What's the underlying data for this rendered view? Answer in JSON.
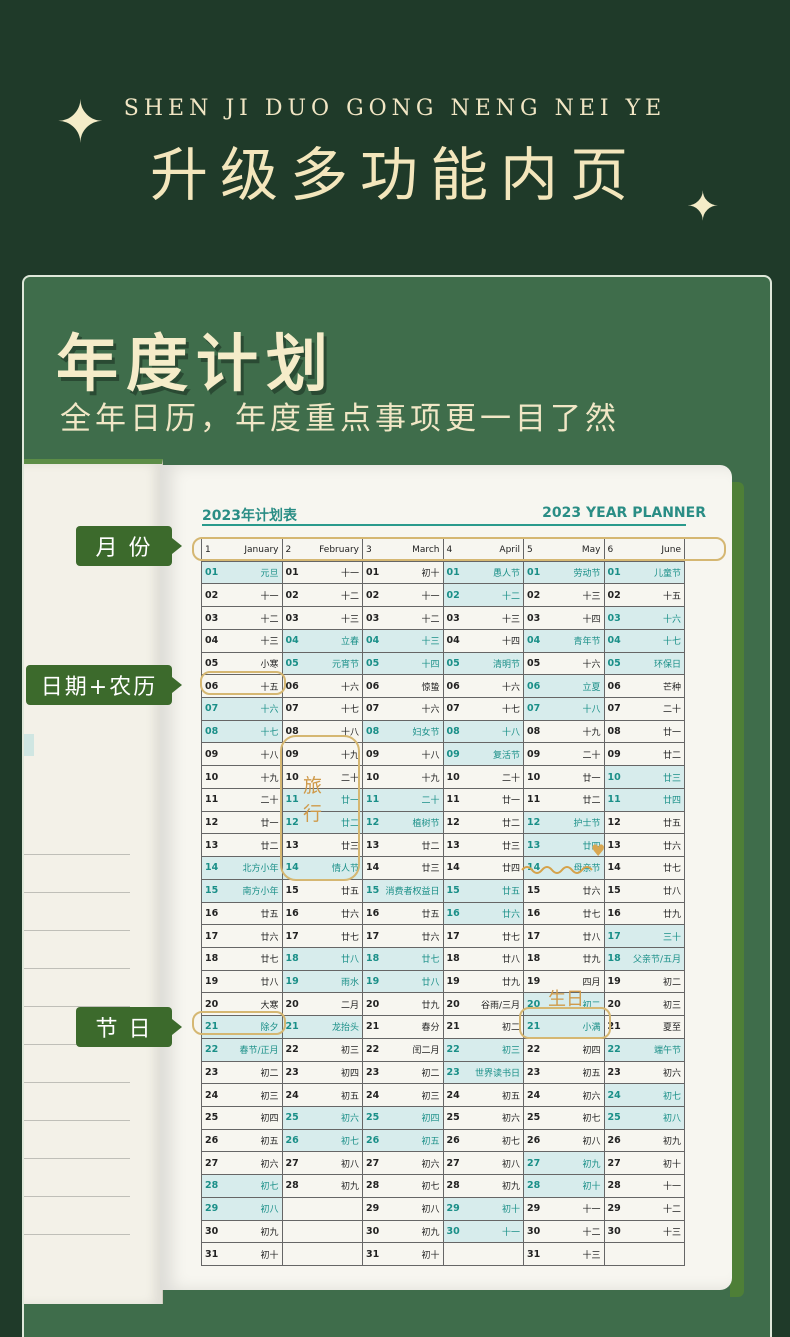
{
  "header": {
    "pinyin": "SHEN JI DUO GONG NENG NEI YE",
    "title": "升级多功能内页",
    "sparkle_glyph": "✦"
  },
  "section": {
    "title": "年度计划",
    "subtitle": "全年日历，年度重点事项更一目了然"
  },
  "callouts": {
    "month": "月 份",
    "date_lunar": "日期+农历",
    "holiday": "节 日"
  },
  "doodles": {
    "travel_1": "旅",
    "travel_2": "行",
    "birthday": "生日",
    "heart": "♥"
  },
  "planner": {
    "title_cn": "2023年计划表",
    "title_en": "2023 YEAR PLANNER",
    "months": [
      {
        "num": "1",
        "name": "January"
      },
      {
        "num": "2",
        "name": "February"
      },
      {
        "num": "3",
        "name": "March"
      },
      {
        "num": "4",
        "name": "April"
      },
      {
        "num": "5",
        "name": "May"
      },
      {
        "num": "6",
        "name": "June"
      }
    ],
    "columns": [
      [
        [
          "01",
          "元旦",
          1
        ],
        [
          "02",
          "十一",
          0
        ],
        [
          "03",
          "十二",
          0
        ],
        [
          "04",
          "十三",
          0
        ],
        [
          "05",
          "小寒",
          0
        ],
        [
          "06",
          "十五",
          0
        ],
        [
          "07",
          "十六",
          1
        ],
        [
          "08",
          "十七",
          1
        ],
        [
          "09",
          "十八",
          0
        ],
        [
          "10",
          "十九",
          0
        ],
        [
          "11",
          "二十",
          0
        ],
        [
          "12",
          "廿一",
          0
        ],
        [
          "13",
          "廿二",
          0
        ],
        [
          "14",
          "北方小年",
          1
        ],
        [
          "15",
          "南方小年",
          1
        ],
        [
          "16",
          "廿五",
          0
        ],
        [
          "17",
          "廿六",
          0
        ],
        [
          "18",
          "廿七",
          0
        ],
        [
          "19",
          "廿八",
          0
        ],
        [
          "20",
          "大寒",
          0
        ],
        [
          "21",
          "除夕",
          1
        ],
        [
          "22",
          "春节/正月",
          1
        ],
        [
          "23",
          "初二",
          0
        ],
        [
          "24",
          "初三",
          0
        ],
        [
          "25",
          "初四",
          0
        ],
        [
          "26",
          "初五",
          0
        ],
        [
          "27",
          "初六",
          0
        ],
        [
          "28",
          "初七",
          1
        ],
        [
          "29",
          "初八",
          1
        ],
        [
          "30",
          "初九",
          0
        ],
        [
          "31",
          "初十",
          0
        ]
      ],
      [
        [
          "01",
          "十一",
          0
        ],
        [
          "02",
          "十二",
          0
        ],
        [
          "03",
          "十三",
          0
        ],
        [
          "04",
          "立春",
          1
        ],
        [
          "05",
          "元宵节",
          1
        ],
        [
          "06",
          "十六",
          0
        ],
        [
          "07",
          "十七",
          0
        ],
        [
          "08",
          "十八",
          0
        ],
        [
          "09",
          "十九",
          0
        ],
        [
          "10",
          "二十",
          0
        ],
        [
          "11",
          "廿一",
          1
        ],
        [
          "12",
          "廿二",
          1
        ],
        [
          "13",
          "廿三",
          0
        ],
        [
          "14",
          "情人节",
          1
        ],
        [
          "15",
          "廿五",
          0
        ],
        [
          "16",
          "廿六",
          0
        ],
        [
          "17",
          "廿七",
          0
        ],
        [
          "18",
          "廿八",
          1
        ],
        [
          "19",
          "雨水",
          1
        ],
        [
          "20",
          "二月",
          0
        ],
        [
          "21",
          "龙抬头",
          1
        ],
        [
          "22",
          "初三",
          0
        ],
        [
          "23",
          "初四",
          0
        ],
        [
          "24",
          "初五",
          0
        ],
        [
          "25",
          "初六",
          1
        ],
        [
          "26",
          "初七",
          1
        ],
        [
          "27",
          "初八",
          0
        ],
        [
          "28",
          "初九",
          0
        ],
        [
          "",
          "",
          0
        ],
        [
          "",
          "",
          0
        ],
        [
          "",
          "",
          0
        ]
      ],
      [
        [
          "01",
          "初十",
          0
        ],
        [
          "02",
          "十一",
          0
        ],
        [
          "03",
          "十二",
          0
        ],
        [
          "04",
          "十三",
          1
        ],
        [
          "05",
          "十四",
          1
        ],
        [
          "06",
          "惊蛰",
          0
        ],
        [
          "07",
          "十六",
          0
        ],
        [
          "08",
          "妇女节",
          1
        ],
        [
          "09",
          "十八",
          0
        ],
        [
          "10",
          "十九",
          0
        ],
        [
          "11",
          "二十",
          1
        ],
        [
          "12",
          "植树节",
          1
        ],
        [
          "13",
          "廿二",
          0
        ],
        [
          "14",
          "廿三",
          0
        ],
        [
          "15",
          "消费者权益日",
          1
        ],
        [
          "16",
          "廿五",
          0
        ],
        [
          "17",
          "廿六",
          0
        ],
        [
          "18",
          "廿七",
          1
        ],
        [
          "19",
          "廿八",
          1
        ],
        [
          "20",
          "廿九",
          0
        ],
        [
          "21",
          "春分",
          0
        ],
        [
          "22",
          "闰二月",
          0
        ],
        [
          "23",
          "初二",
          0
        ],
        [
          "24",
          "初三",
          0
        ],
        [
          "25",
          "初四",
          1
        ],
        [
          "26",
          "初五",
          1
        ],
        [
          "27",
          "初六",
          0
        ],
        [
          "28",
          "初七",
          0
        ],
        [
          "29",
          "初八",
          0
        ],
        [
          "30",
          "初九",
          0
        ],
        [
          "31",
          "初十",
          0
        ]
      ],
      [
        [
          "01",
          "愚人节",
          1
        ],
        [
          "02",
          "十二",
          1
        ],
        [
          "03",
          "十三",
          0
        ],
        [
          "04",
          "十四",
          0
        ],
        [
          "05",
          "清明节",
          1
        ],
        [
          "06",
          "十六",
          0
        ],
        [
          "07",
          "十七",
          0
        ],
        [
          "08",
          "十八",
          1
        ],
        [
          "09",
          "复活节",
          1
        ],
        [
          "10",
          "二十",
          0
        ],
        [
          "11",
          "廿一",
          0
        ],
        [
          "12",
          "廿二",
          0
        ],
        [
          "13",
          "廿三",
          0
        ],
        [
          "14",
          "廿四",
          0
        ],
        [
          "15",
          "廿五",
          1
        ],
        [
          "16",
          "廿六",
          1
        ],
        [
          "17",
          "廿七",
          0
        ],
        [
          "18",
          "廿八",
          0
        ],
        [
          "19",
          "廿九",
          0
        ],
        [
          "20",
          "谷雨/三月",
          0
        ],
        [
          "21",
          "初二",
          0
        ],
        [
          "22",
          "初三",
          1
        ],
        [
          "23",
          "世界读书日",
          1
        ],
        [
          "24",
          "初五",
          0
        ],
        [
          "25",
          "初六",
          0
        ],
        [
          "26",
          "初七",
          0
        ],
        [
          "27",
          "初八",
          0
        ],
        [
          "28",
          "初九",
          0
        ],
        [
          "29",
          "初十",
          1
        ],
        [
          "30",
          "十一",
          1
        ],
        [
          "",
          "",
          0
        ]
      ],
      [
        [
          "01",
          "劳动节",
          1
        ],
        [
          "02",
          "十三",
          0
        ],
        [
          "03",
          "十四",
          0
        ],
        [
          "04",
          "青年节",
          1
        ],
        [
          "05",
          "十六",
          0
        ],
        [
          "06",
          "立夏",
          1
        ],
        [
          "07",
          "十八",
          1
        ],
        [
          "08",
          "十九",
          0
        ],
        [
          "09",
          "二十",
          0
        ],
        [
          "10",
          "廿一",
          0
        ],
        [
          "11",
          "廿二",
          0
        ],
        [
          "12",
          "护士节",
          1
        ],
        [
          "13",
          "廿四",
          1
        ],
        [
          "14",
          "母亲节",
          1
        ],
        [
          "15",
          "廿六",
          0
        ],
        [
          "16",
          "廿七",
          0
        ],
        [
          "17",
          "廿八",
          0
        ],
        [
          "18",
          "廿九",
          0
        ],
        [
          "19",
          "四月",
          0
        ],
        [
          "20",
          "初二",
          1
        ],
        [
          "21",
          "小满",
          1
        ],
        [
          "22",
          "初四",
          0
        ],
        [
          "23",
          "初五",
          0
        ],
        [
          "24",
          "初六",
          0
        ],
        [
          "25",
          "初七",
          0
        ],
        [
          "26",
          "初八",
          0
        ],
        [
          "27",
          "初九",
          1
        ],
        [
          "28",
          "初十",
          1
        ],
        [
          "29",
          "十一",
          0
        ],
        [
          "30",
          "十二",
          0
        ],
        [
          "31",
          "十三",
          0
        ]
      ],
      [
        [
          "01",
          "儿童节",
          1
        ],
        [
          "02",
          "十五",
          0
        ],
        [
          "03",
          "十六",
          1
        ],
        [
          "04",
          "十七",
          1
        ],
        [
          "05",
          "环保日",
          1
        ],
        [
          "06",
          "芒种",
          0
        ],
        [
          "07",
          "二十",
          0
        ],
        [
          "08",
          "廿一",
          0
        ],
        [
          "09",
          "廿二",
          0
        ],
        [
          "10",
          "廿三",
          1
        ],
        [
          "11",
          "廿四",
          1
        ],
        [
          "12",
          "廿五",
          0
        ],
        [
          "13",
          "廿六",
          0
        ],
        [
          "14",
          "廿七",
          0
        ],
        [
          "15",
          "廿八",
          0
        ],
        [
          "16",
          "廿九",
          0
        ],
        [
          "17",
          "三十",
          1
        ],
        [
          "18",
          "父亲节/五月",
          1
        ],
        [
          "19",
          "初二",
          0
        ],
        [
          "20",
          "初三",
          0
        ],
        [
          "21",
          "夏至",
          0
        ],
        [
          "22",
          "端午节",
          1
        ],
        [
          "23",
          "初六",
          0
        ],
        [
          "24",
          "初七",
          1
        ],
        [
          "25",
          "初八",
          1
        ],
        [
          "26",
          "初九",
          0
        ],
        [
          "27",
          "初十",
          0
        ],
        [
          "28",
          "十一",
          0
        ],
        [
          "29",
          "十二",
          0
        ],
        [
          "30",
          "十三",
          0
        ],
        [
          "",
          "",
          0
        ]
      ]
    ]
  }
}
